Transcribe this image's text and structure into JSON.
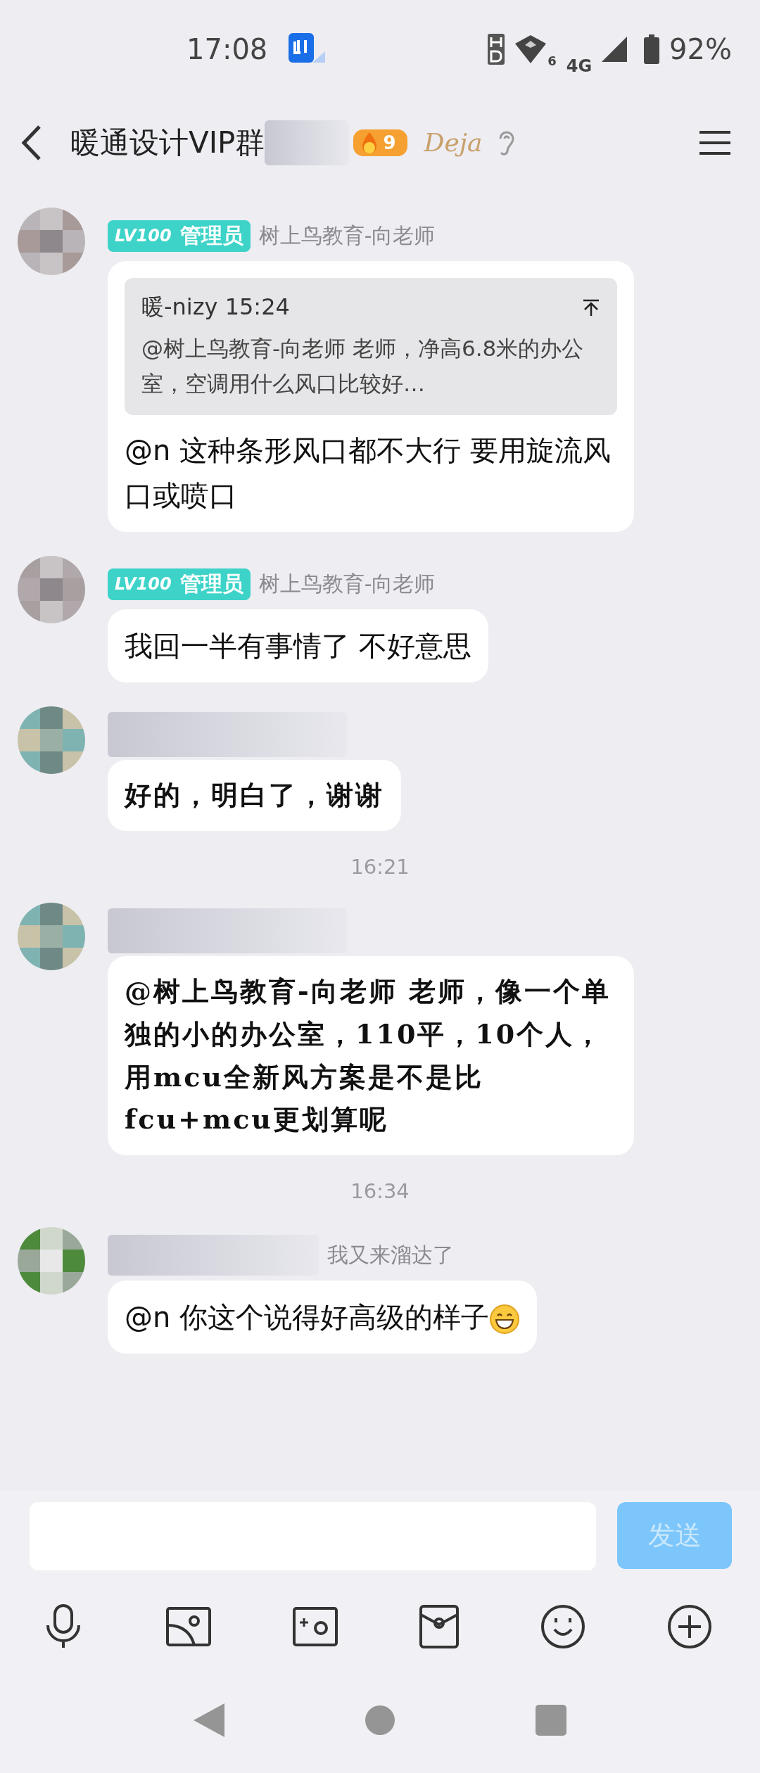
{
  "status_bar": {
    "time": "17:08",
    "wifi_badge": "6",
    "network": "4G",
    "battery": "92%"
  },
  "title_bar": {
    "title": "暖通设计VIP群",
    "title_blurred": true,
    "fire_level": "9",
    "signature": "Deja"
  },
  "messages": [
    {
      "kind": "plain",
      "sender": {
        "blurred": false,
        "badge_level": "LV100",
        "badge_role": "管理员",
        "name": "树上鸟教育-向老师"
      },
      "quote": {
        "author": "暖-nizy 15:24",
        "text": "@树上鸟教育-向老师 老师，净高6.8米的办公室，空调用什么风口比较好…"
      },
      "text": "@n 这种条形风口都不大行 要用旋流风口或喷口"
    },
    {
      "kind": "plain",
      "sender": {
        "blurred": false,
        "badge_level": "LV100",
        "badge_role": "管理员",
        "name": "树上鸟教育-向老师"
      },
      "text": "我回一半有事情了 不好意思"
    },
    {
      "kind": "handwritten",
      "sender": {
        "blurred": true
      },
      "text": "好的，明白了，谢谢"
    },
    {
      "kind": "time",
      "text": "16:21"
    },
    {
      "kind": "handwritten",
      "sender": {
        "blurred": true
      },
      "text": "@树上鸟教育-向老师 老师，像一个单独的小的办公室，110平，10个人，用mcu全新风方案是不是比fcu+mcu更划算呢"
    },
    {
      "kind": "time",
      "text": "16:34"
    },
    {
      "kind": "plain",
      "sender": {
        "blurred": true,
        "name": "我又来溜达了"
      },
      "text": "@n 你这个说得好高级的样子"
    }
  ],
  "composer": {
    "send_label": "发送",
    "send_disabled": true
  }
}
